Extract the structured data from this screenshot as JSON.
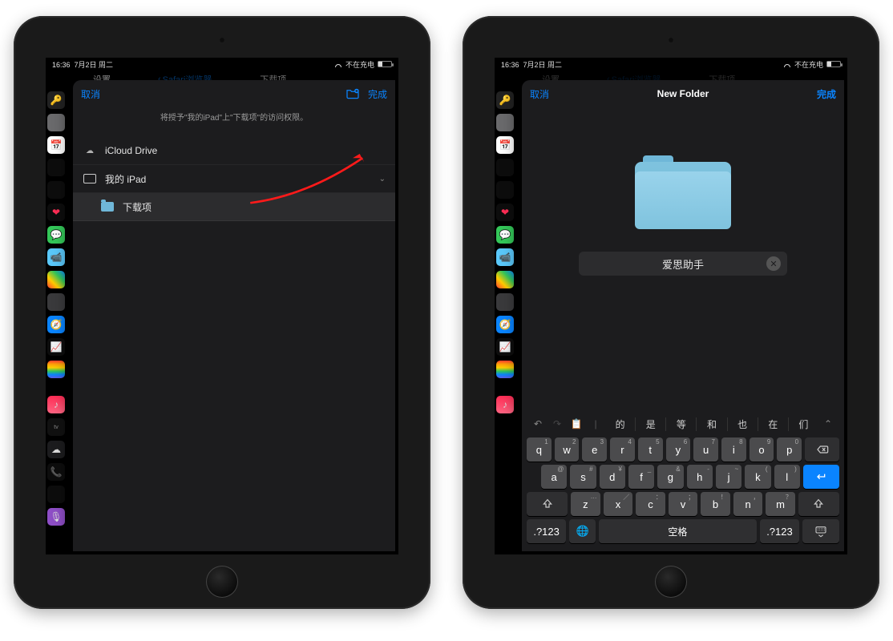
{
  "status": {
    "time": "16:36",
    "date": "7月2日 周二",
    "charge_label": "不在充电"
  },
  "bg": {
    "settings_title": "设置",
    "back_label": "Safari浏览器",
    "page_title": "下载项"
  },
  "sheet1": {
    "cancel": "取消",
    "done": "完成",
    "subtitle": "将授予\"我的iPad\"上\"下载项\"的访问权限。",
    "rows": {
      "icloud": "iCloud Drive",
      "myipad": "我的 iPad",
      "downloads": "下载项"
    }
  },
  "sheet2": {
    "cancel": "取消",
    "title": "New Folder",
    "done": "完成",
    "folder_name": "爱思助手"
  },
  "keyboard": {
    "candidates": [
      "的",
      "是",
      "等",
      "和",
      "也",
      "在",
      "们"
    ],
    "row1": [
      {
        "k": "q",
        "a": "1"
      },
      {
        "k": "w",
        "a": "2"
      },
      {
        "k": "e",
        "a": "3"
      },
      {
        "k": "r",
        "a": "4"
      },
      {
        "k": "t",
        "a": "5"
      },
      {
        "k": "y",
        "a": "6"
      },
      {
        "k": "u",
        "a": "7"
      },
      {
        "k": "i",
        "a": "8"
      },
      {
        "k": "o",
        "a": "9"
      },
      {
        "k": "p",
        "a": "0"
      }
    ],
    "row2": [
      {
        "k": "a",
        "a": "@"
      },
      {
        "k": "s",
        "a": "#"
      },
      {
        "k": "d",
        "a": "¥"
      },
      {
        "k": "f",
        "a": "_"
      },
      {
        "k": "g",
        "a": "&"
      },
      {
        "k": "h",
        "a": "-"
      },
      {
        "k": "j",
        "a": "~"
      },
      {
        "k": "k",
        "a": "("
      },
      {
        "k": "l",
        "a": ")"
      }
    ],
    "row3": [
      {
        "k": "z",
        "a": "…"
      },
      {
        "k": "x",
        "a": "／"
      },
      {
        "k": "c",
        "a": "："
      },
      {
        "k": "v",
        "a": "；"
      },
      {
        "k": "b",
        "a": "！"
      },
      {
        "k": "n",
        "a": "，"
      },
      {
        "k": "m",
        "a": "？"
      }
    ],
    "numkey": ".?123",
    "space": "空格"
  },
  "dock_colors": {
    "left": [
      "#222",
      "#6a6a6c",
      "#ff3b30",
      "#1c1c1e",
      "#1c1c1e",
      "#ff2d55",
      "#34c759",
      "#5ac8fa",
      "#5e5ce6",
      "#3a3a3c",
      "#0a84ff",
      "#3a3a3c",
      "#ff9f0a"
    ],
    "left_bottom": [
      "#ff2d55",
      "#111",
      "#2c2c2e",
      "#30d158",
      "#8e4ec6",
      "#af52de"
    ]
  }
}
